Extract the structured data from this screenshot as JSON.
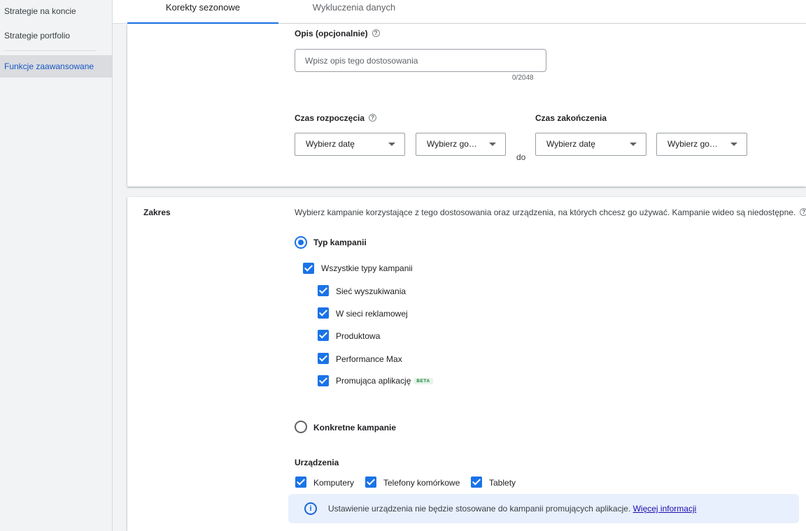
{
  "sidebar": {
    "items": [
      {
        "label": "Strategie na koncie"
      },
      {
        "label": "Strategie portfolio"
      },
      {
        "label": "Funkcje zaawansowane"
      }
    ]
  },
  "tabs": [
    {
      "label": "Korekty sezonowe",
      "active": true
    },
    {
      "label": "Wykluczenia danych",
      "active": false
    }
  ],
  "description_section": {
    "label": "Opis (opcjonalnie)",
    "input_placeholder": "Wpisz opis tego dostosowania",
    "input_value": "",
    "counter": "0/2048"
  },
  "time_section": {
    "start_label": "Czas rozpoczęcia",
    "end_label": "Czas zakończenia",
    "start_date": "Wybierz datę",
    "start_time": "Wybierz go…",
    "separator": "do",
    "end_date": "Wybierz datę",
    "end_time": "Wybierz go…"
  },
  "scope": {
    "title": "Zakres",
    "description": "Wybierz kampanie korzystające z tego dostosowania oraz urządzenia, na których chcesz go używać. Kampanie wideo są niedostępne.",
    "campaign_type_option": "Typ kampanii",
    "campaign_type_selected": true,
    "all_types_label": "Wszystkie typy kampanii",
    "types": [
      {
        "label": "Sieć wyszukiwania",
        "checked": true
      },
      {
        "label": "W sieci reklamowej",
        "checked": true
      },
      {
        "label": "Produktowa",
        "checked": true
      },
      {
        "label": "Performance Max",
        "checked": true
      },
      {
        "label": "Promująca aplikację",
        "checked": true,
        "badge": "BETA"
      }
    ],
    "specific_campaigns_option": "Konkretne kampanie",
    "devices_title": "Urządzenia",
    "devices": [
      {
        "label": "Komputery",
        "checked": true
      },
      {
        "label": "Telefony komórkowe",
        "checked": true
      },
      {
        "label": "Tablety",
        "checked": true
      }
    ],
    "info_text": "Ustawienie urządzenia nie będzie stosowane do kampanii promujących aplikacje.",
    "info_link": "Więcej informacji"
  },
  "colors": {
    "accent": "#1a73e8",
    "sidebar_active_text": "#1a56c4",
    "info_bg": "#e8f0fe"
  },
  "icons": [
    "help-icon",
    "chevron-down-icon",
    "info-icon",
    "checkbox-checked-icon",
    "radio-selected-icon"
  ]
}
